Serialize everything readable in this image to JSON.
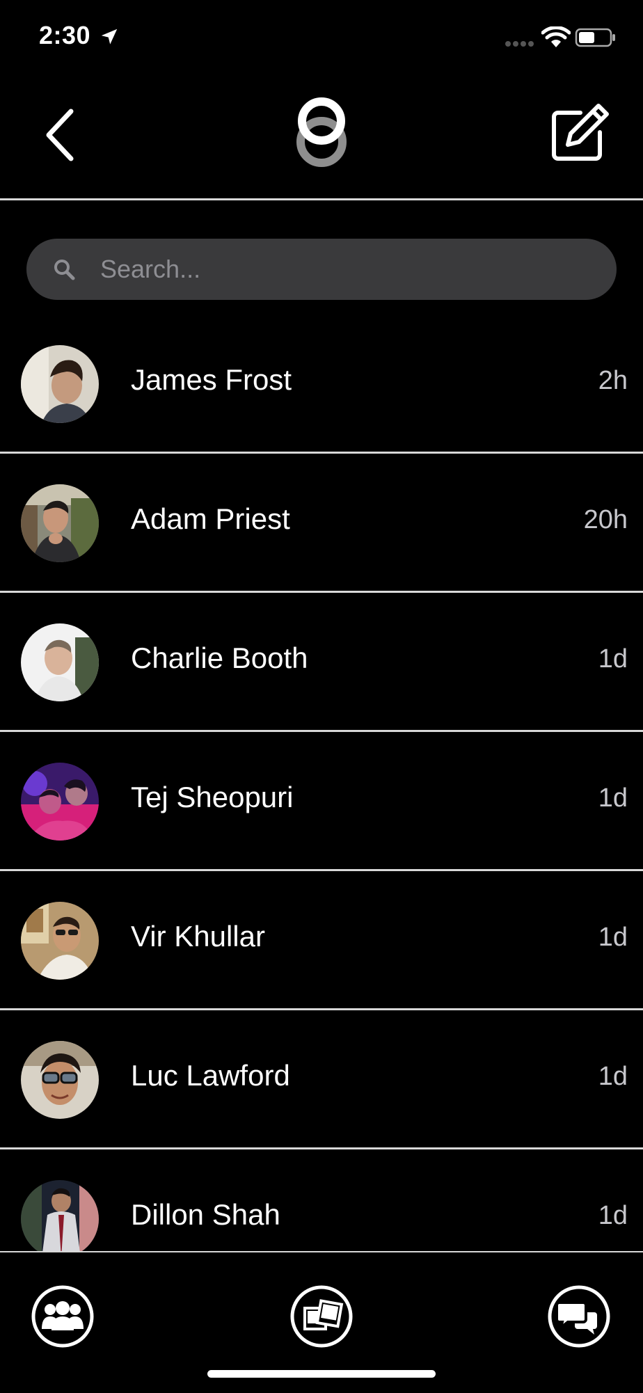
{
  "status_bar": {
    "time": "2:30"
  },
  "icons": {
    "location": "location-arrow-icon",
    "wifi": "wifi-icon",
    "battery": "battery-icon",
    "back": "chevron-left-icon",
    "logo": "app-logo-icon",
    "compose": "compose-icon",
    "search": "search-icon",
    "friends_tab": "friends-group-icon",
    "gallery_tab": "photos-gallery-icon",
    "messages_tab": "chat-bubbles-icon"
  },
  "search": {
    "placeholder": "Search...",
    "value": ""
  },
  "conversations": [
    {
      "name": "James Frost",
      "time": "2h"
    },
    {
      "name": "Adam Priest",
      "time": "20h"
    },
    {
      "name": "Charlie Booth",
      "time": "1d"
    },
    {
      "name": "Tej Sheopuri",
      "time": "1d"
    },
    {
      "name": "Vir Khullar",
      "time": "1d"
    },
    {
      "name": "Luc Lawford",
      "time": "1d"
    },
    {
      "name": "Dillon Shah",
      "time": "1d"
    }
  ],
  "colors": {
    "background": "#000000",
    "search_background": "#3a3a3c",
    "divider": "#d8d8d8",
    "secondary_text": "#c7c7cc"
  }
}
